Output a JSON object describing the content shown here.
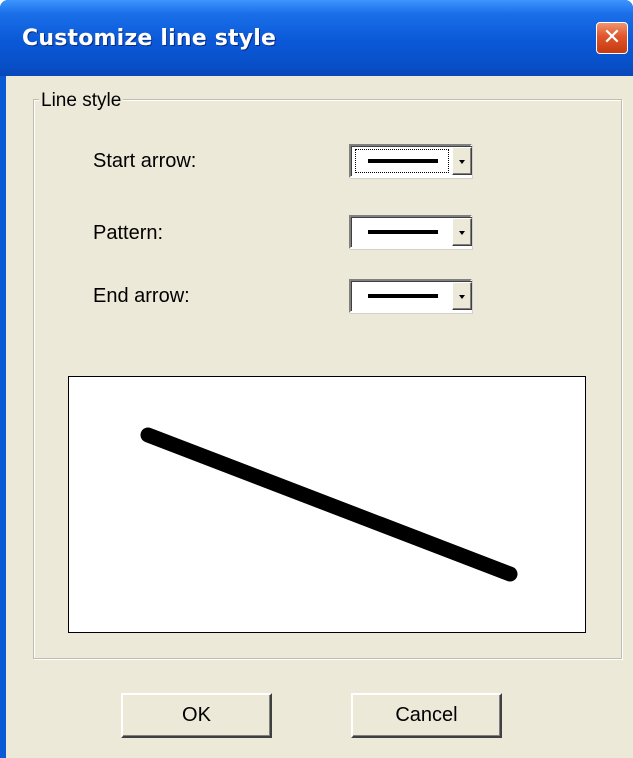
{
  "window": {
    "title": "Customize line style",
    "close_symbol": "✕"
  },
  "group": {
    "label": "Line style"
  },
  "fields": {
    "start_arrow_label": "Start arrow:",
    "pattern_label": "Pattern:",
    "end_arrow_label": "End arrow:"
  },
  "buttons": {
    "ok": "OK",
    "cancel": "Cancel"
  },
  "colors": {
    "title_bar": "#0a58d8",
    "dialog_face": "#ece9d8",
    "close_button": "#e0552b"
  }
}
